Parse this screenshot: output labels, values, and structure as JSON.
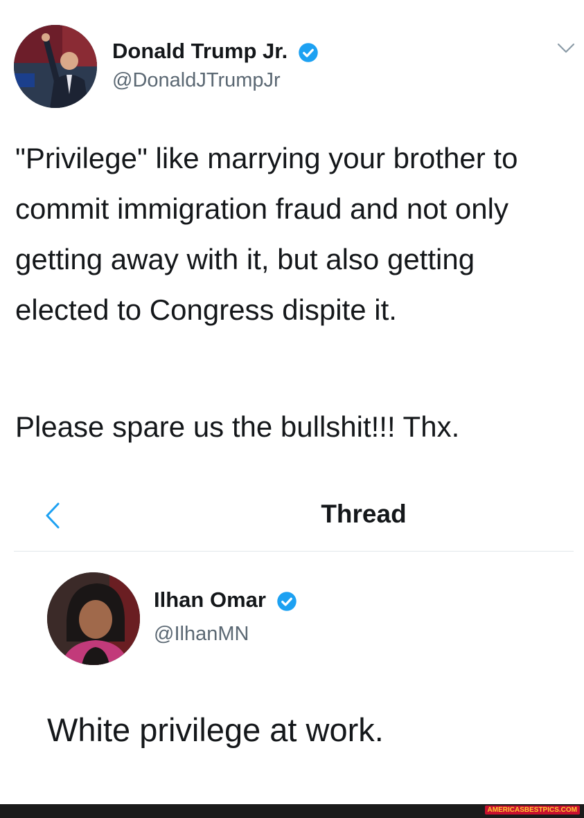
{
  "tweet_main": {
    "author_name": "Donald Trump Jr.",
    "author_handle": "@DonaldJTrumpJr",
    "text_para1": "\"Privilege\" like marrying your brother to commit immigration fraud and not only getting away with it, but also getting elected to Congress dispite it.",
    "text_para2": "Please spare us the bullshit!!! Thx.",
    "verified_color": "#1da1f2"
  },
  "thread_header": {
    "title": "Thread"
  },
  "tweet_reply": {
    "author_name": "Ilhan Omar",
    "author_handle": "@IlhanMN",
    "text": "White privilege at work."
  },
  "footer": {
    "watermark": "AMERICASBESTPICS.COM"
  },
  "icons": {
    "verified": "verified-badge-icon",
    "menu": "chevron-down-icon",
    "back": "chevron-left-icon"
  }
}
